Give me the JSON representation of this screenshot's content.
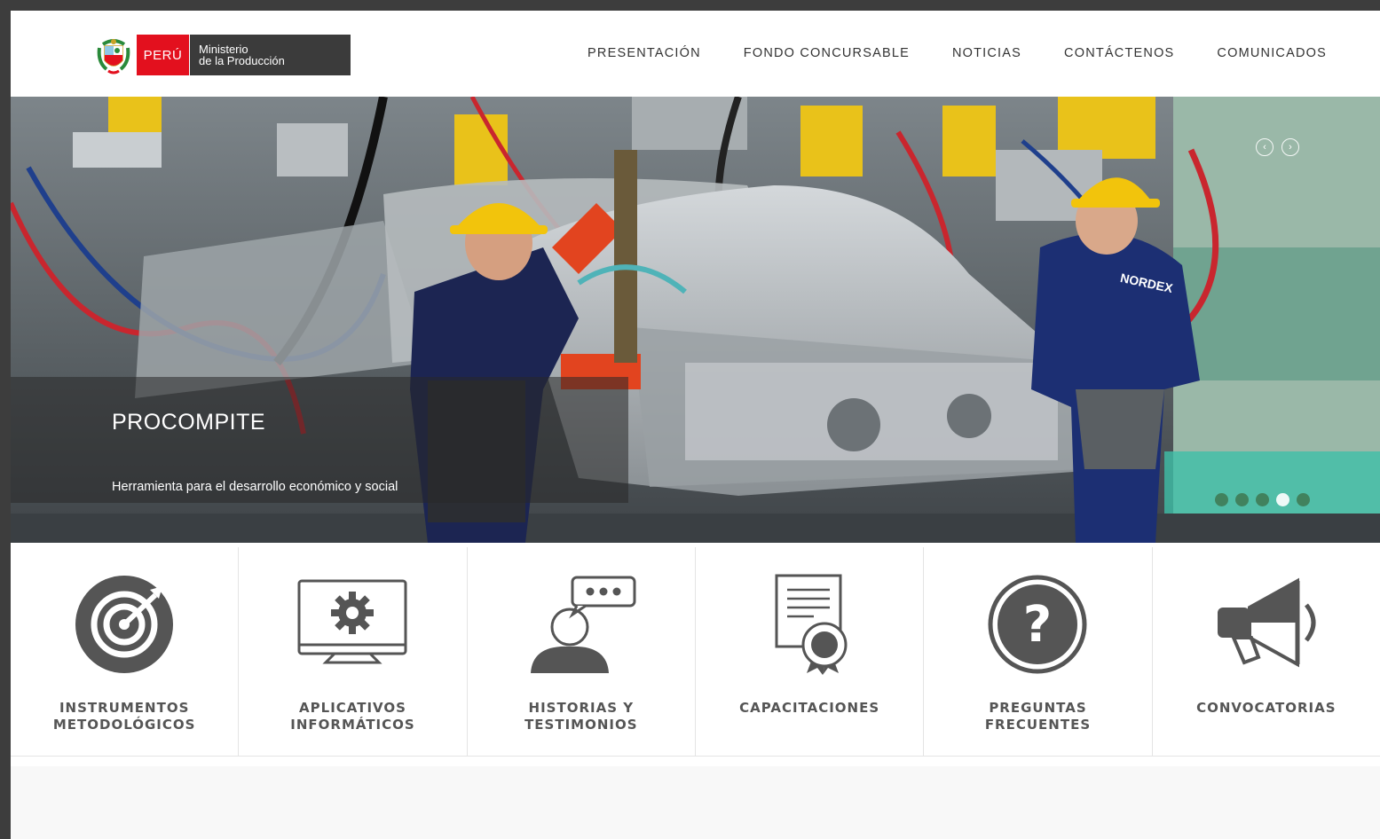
{
  "header": {
    "logo": {
      "country": "PERÚ",
      "ministry_line1": "Ministerio",
      "ministry_line2": "de la Producción",
      "icon": "peru-coat-of-arms-icon"
    },
    "nav": [
      {
        "label": "PRESENTACIÓN"
      },
      {
        "label": "FONDO CONCURSABLE"
      },
      {
        "label": "NOTICIAS"
      },
      {
        "label": "CONTÁCTENOS"
      },
      {
        "label": "COMUNICADOS"
      }
    ]
  },
  "hero": {
    "title": "PROCOMPITE",
    "subtitle": "Herramienta para el desarrollo económico y social",
    "worker_jacket_text": "NORDEX",
    "prev_icon": "chevron-left-circle-icon",
    "next_icon": "chevron-right-circle-icon",
    "slide_count": 5,
    "active_slide": 4
  },
  "features": [
    {
      "line1": "INSTRUMENTOS",
      "line2": "METODOLÓGICOS",
      "icon": "target-icon"
    },
    {
      "line1": "APLICATIVOS",
      "line2": "INFORMÁTICOS",
      "icon": "monitor-gear-icon"
    },
    {
      "line1": "HISTORIAS Y",
      "line2": "TESTIMONIOS",
      "icon": "person-speech-bubble-icon"
    },
    {
      "line1": "CAPACITACIONES",
      "line2": "",
      "icon": "certificate-icon"
    },
    {
      "line1": "PREGUNTAS",
      "line2": "FRECUENTES",
      "icon": "question-circle-icon"
    },
    {
      "line1": "CONVOCATORIAS",
      "line2": "",
      "icon": "megaphone-icon"
    }
  ],
  "colors": {
    "brand_red": "#e3101e",
    "ministry_gray": "#3b3b3b",
    "icon_gray": "#555555",
    "helmet_yellow": "#f2c40c",
    "jacket_blue": "#1c2f73"
  }
}
